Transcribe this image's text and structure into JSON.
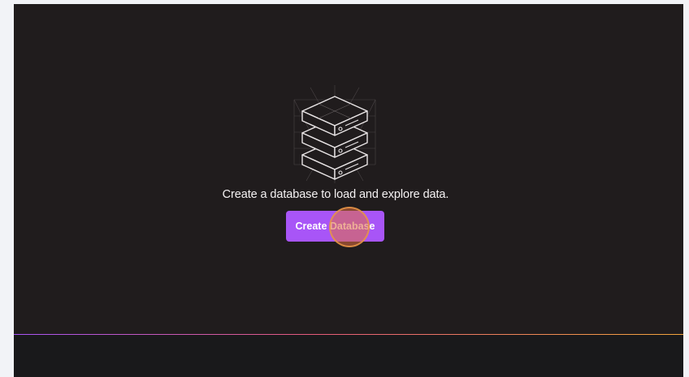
{
  "empty_state": {
    "illustration_icon": "database-stack-icon",
    "message": "Create a database to load and explore data.",
    "create_button_label": "Create Database"
  },
  "colors": {
    "background": "#201c1d",
    "accent": "#a855f7",
    "divider_gradient": [
      "#a855f7",
      "#e65b7a",
      "#f3a53c"
    ]
  }
}
